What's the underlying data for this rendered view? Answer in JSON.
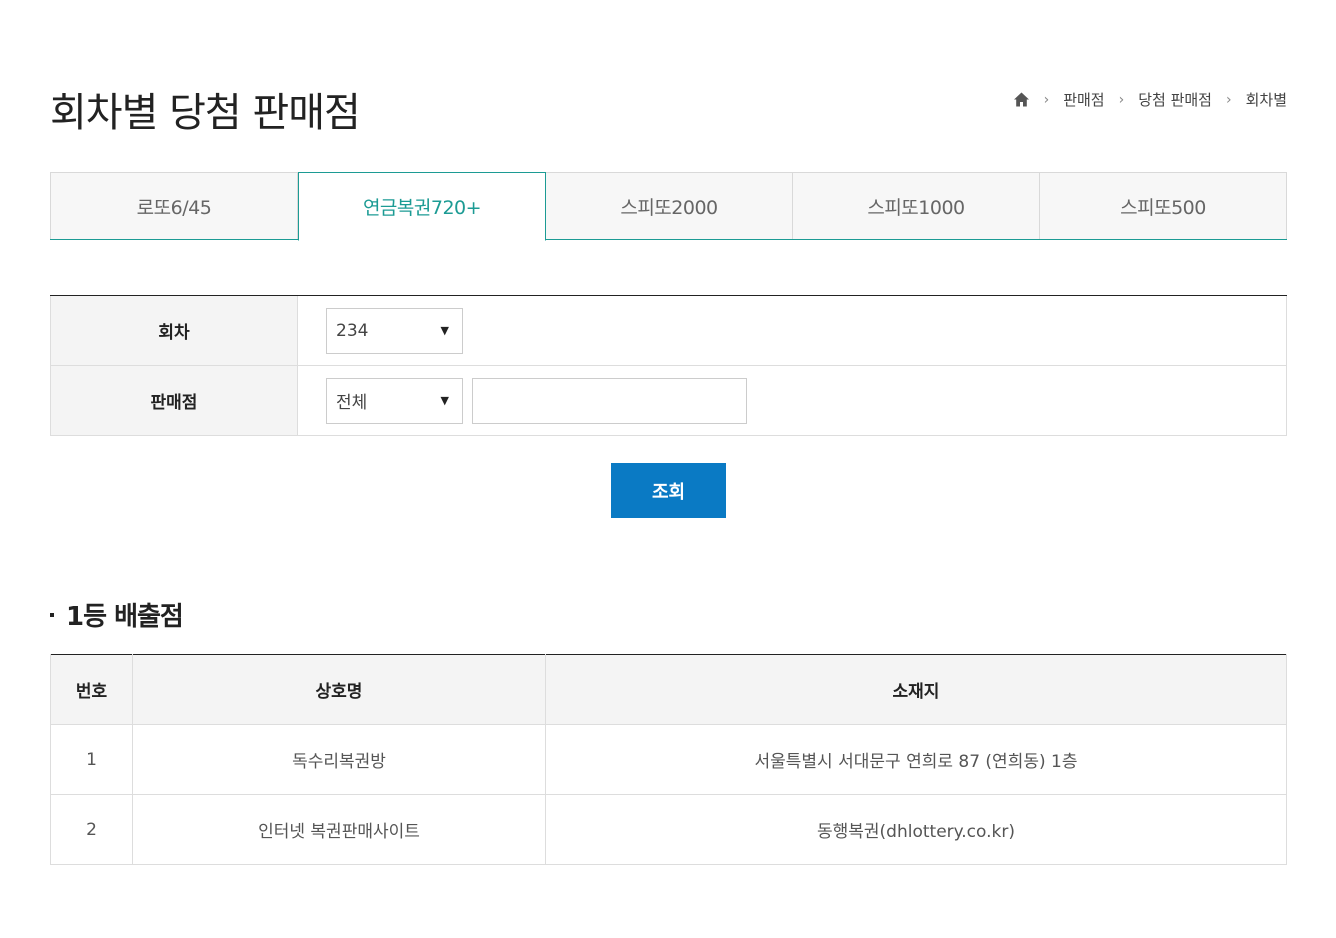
{
  "page": {
    "title": "회차별 당첨 판매점"
  },
  "breadcrumb": {
    "home_icon": "home-icon",
    "items": [
      "판매점",
      "당첨 판매점",
      "회차별"
    ]
  },
  "tabs": [
    {
      "label": "로또6/45",
      "active": false
    },
    {
      "label": "연금복권720+",
      "active": true
    },
    {
      "label": "스피또2000",
      "active": false
    },
    {
      "label": "스피또1000",
      "active": false
    },
    {
      "label": "스피또500",
      "active": false
    }
  ],
  "search": {
    "round_label": "회차",
    "round_value": "234",
    "store_label": "판매점",
    "store_filter_value": "전체",
    "store_text_value": "",
    "submit_label": "조회"
  },
  "results": {
    "section_title": "1등 배출점",
    "headers": [
      "번호",
      "상호명",
      "소재지"
    ],
    "rows": [
      {
        "no": "1",
        "name": "독수리복권방",
        "address": "서울특별시 서대문구 연희로 87 (연희동) 1층"
      },
      {
        "no": "2",
        "name": "인터넷 복권판매사이트",
        "address": "동행복권(dhlottery.co.kr)"
      }
    ]
  },
  "colors": {
    "accent_teal": "#1c9b94",
    "button_blue": "#0a7ac4"
  }
}
